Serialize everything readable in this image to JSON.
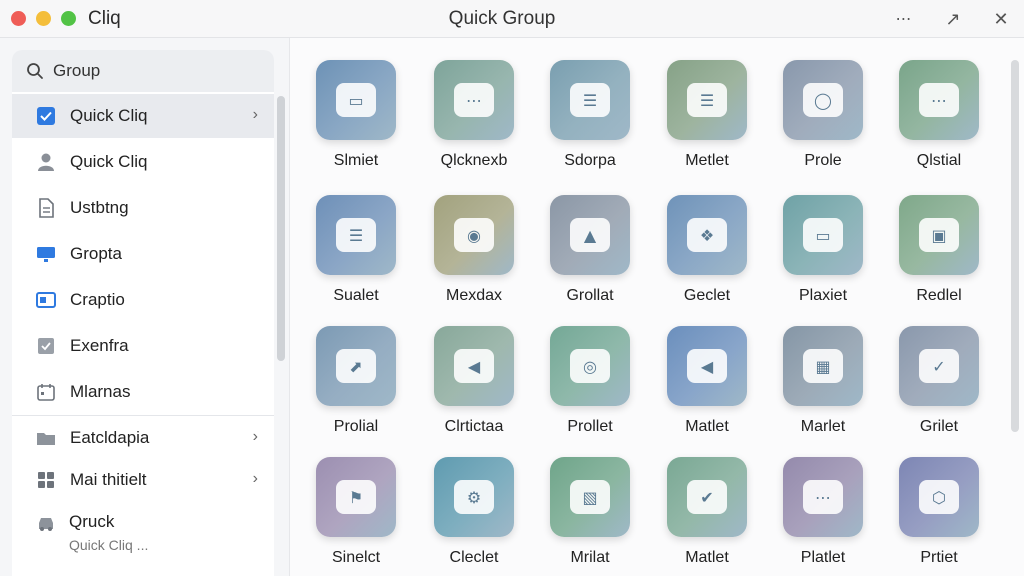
{
  "window": {
    "app_name": "Cliq",
    "title": "Quick Group",
    "more_glyph": "⋯",
    "popout_glyph": "↗",
    "close_glyph": "✕"
  },
  "sidebar": {
    "search": {
      "label": "Group",
      "icon": "search-icon"
    },
    "items": [
      {
        "label": "Quick Cliq",
        "icon": "checkbox-icon",
        "glyph": "☑",
        "color": "#2f7ae0",
        "chevron": "›"
      },
      {
        "label": "Quick Cliq",
        "icon": "user-icon",
        "glyph": "☺",
        "color": "#8a8f97"
      },
      {
        "label": "Ustbtng",
        "icon": "document-icon",
        "glyph": "☷",
        "color": "#6d737b"
      },
      {
        "label": "Gropta",
        "icon": "monitor-icon",
        "glyph": "▬",
        "color": "#2f7ae0"
      },
      {
        "label": "Craptio",
        "icon": "card-icon",
        "glyph": "▣",
        "color": "#2f7ae0"
      },
      {
        "label": "Exenfra",
        "icon": "check-square-icon",
        "glyph": "✓",
        "color": "#7a8088"
      },
      {
        "label": "Mlarnas",
        "icon": "calendar-icon",
        "glyph": "☷",
        "color": "#6d737b"
      },
      {
        "label": "Eatcldapia",
        "icon": "folder-icon",
        "glyph": "▬",
        "color": "#7a8088",
        "chevron": "›"
      },
      {
        "label": "Mai thitielt",
        "icon": "grid-icon",
        "glyph": "▦",
        "color": "#6d737b",
        "chevron": "›"
      }
    ],
    "two_line_item": {
      "title": "Qruck",
      "subtitle": "Quick Cliq ...",
      "icon": "car-icon",
      "glyph": "▤"
    }
  },
  "grid": {
    "tiles": [
      {
        "label": "Slmiet",
        "icon": "id-card-chat-icon",
        "glyph": "▭",
        "color": "#6d92b6"
      },
      {
        "label": "Qlcknexb",
        "icon": "chat-bubble-icon",
        "glyph": "⋯",
        "color": "#7ea49a"
      },
      {
        "label": "Sdorpa",
        "icon": "filter-chat-icon",
        "glyph": "☰",
        "color": "#7a9fb0"
      },
      {
        "label": "Metlet",
        "icon": "list-chat-icon",
        "glyph": "☰",
        "color": "#86a287"
      },
      {
        "label": "Prole",
        "icon": "speech-bubble-icon",
        "glyph": "◯",
        "color": "#8998ac"
      },
      {
        "label": "Qlstial",
        "icon": "chat-dots-icon",
        "glyph": "⋯",
        "color": "#7aa58a"
      },
      {
        "label": "Sualet",
        "icon": "message-box-icon",
        "glyph": "☰",
        "color": "#6e90b8"
      },
      {
        "label": "Mexdax",
        "icon": "bandage-icon",
        "glyph": "◉",
        "color": "#a2a27e"
      },
      {
        "label": "Grollat",
        "icon": "image-card-icon",
        "glyph": "▲",
        "color": "#8b97a6"
      },
      {
        "label": "Geclet",
        "icon": "calendar-app-icon",
        "glyph": "❖",
        "color": "#6f93b9"
      },
      {
        "label": "Plaxiet",
        "icon": "tablet-icon",
        "glyph": "▭",
        "color": "#6fa2a6"
      },
      {
        "label": "Redlel",
        "icon": "news-card-icon",
        "glyph": "▣",
        "color": "#7fa88a"
      },
      {
        "label": "Prolial",
        "icon": "compass-icon",
        "glyph": "⬈",
        "color": "#7c9ab4"
      },
      {
        "label": "Clrtictaa",
        "icon": "megaphone-icon",
        "glyph": "◀",
        "color": "#88a89a"
      },
      {
        "label": "Prollet",
        "icon": "signal-icon",
        "glyph": "◎",
        "color": "#74a896"
      },
      {
        "label": "Matlet",
        "icon": "speaker-icon",
        "glyph": "◀",
        "color": "#6b8fbd"
      },
      {
        "label": "Marlet",
        "icon": "dashboard-icon",
        "glyph": "▦",
        "color": "#8596a6"
      },
      {
        "label": "Grilet",
        "icon": "chat-check-icon",
        "glyph": "✓",
        "color": "#8a98ac"
      },
      {
        "label": "Sinelct",
        "icon": "flag-icon",
        "glyph": "⚑",
        "color": "#9c8fb1"
      },
      {
        "label": "Cleclet",
        "icon": "gear-icon",
        "glyph": "⚙",
        "color": "#5f9bb0"
      },
      {
        "label": "Mrilat",
        "icon": "puzzle-icon",
        "glyph": "▧",
        "color": "#6fa58a"
      },
      {
        "label": "Matlet",
        "icon": "inbox-check-icon",
        "glyph": "✔",
        "color": "#7aa894"
      },
      {
        "label": "Platlet",
        "icon": "ellipsis-bubble-icon",
        "glyph": "⋯",
        "color": "#948aac"
      },
      {
        "label": "Prtiet",
        "icon": "shield-chat-icon",
        "glyph": "⬡",
        "color": "#7d86b4"
      }
    ]
  }
}
